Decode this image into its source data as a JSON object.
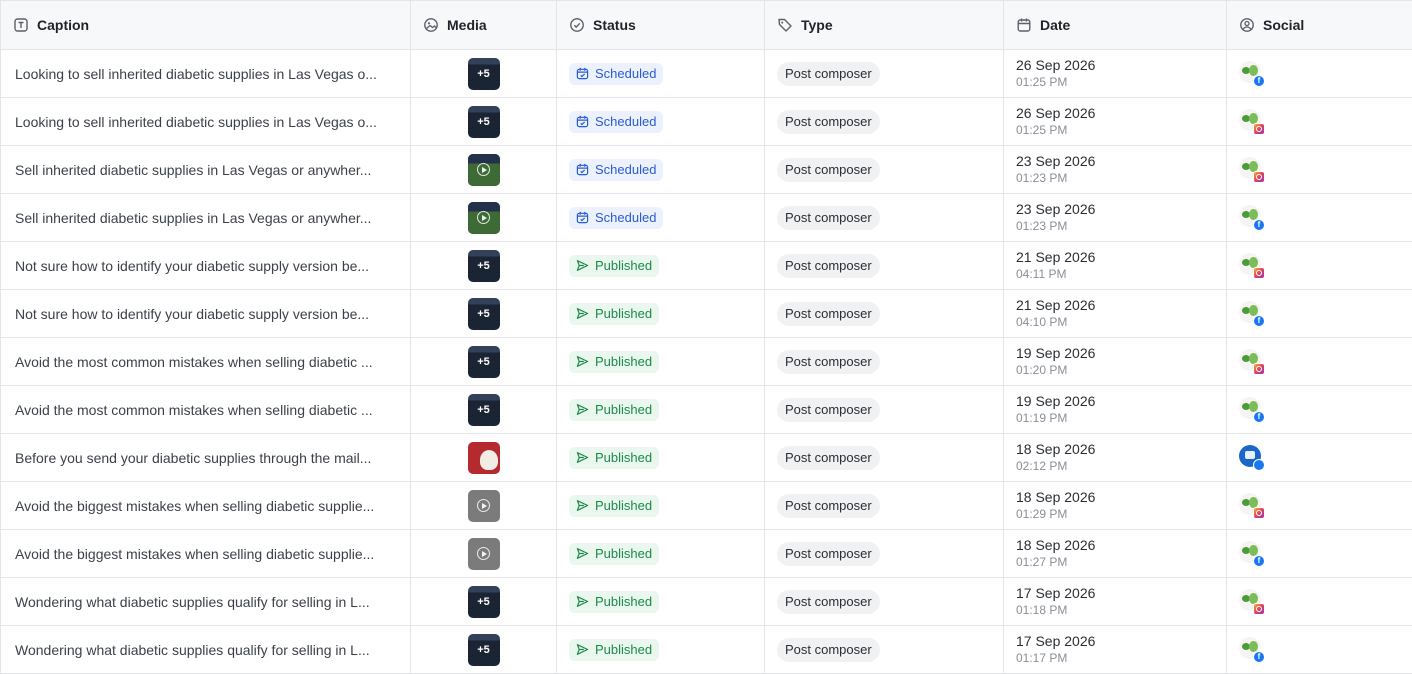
{
  "headers": {
    "caption": "Caption",
    "media": "Media",
    "status": "Status",
    "type": "Type",
    "date": "Date",
    "social": "Social"
  },
  "rows": [
    {
      "caption": "Looking to sell inherited diabetic supplies in Las Vegas o...",
      "media": "plus5",
      "media_text": "+5",
      "status": "Scheduled",
      "type": "Post composer",
      "date": "26 Sep 2026",
      "time": "01:25 PM",
      "network": "facebook"
    },
    {
      "caption": "Looking to sell inherited diabetic supplies in Las Vegas o...",
      "media": "plus5",
      "media_text": "+5",
      "status": "Scheduled",
      "type": "Post composer",
      "date": "26 Sep 2026",
      "time": "01:25 PM",
      "network": "instagram"
    },
    {
      "caption": "Sell inherited diabetic supplies in Las Vegas or anywher...",
      "media": "video",
      "media_text": "",
      "status": "Scheduled",
      "type": "Post composer",
      "date": "23 Sep 2026",
      "time": "01:23 PM",
      "network": "instagram"
    },
    {
      "caption": "Sell inherited diabetic supplies in Las Vegas or anywher...",
      "media": "video",
      "media_text": "",
      "status": "Scheduled",
      "type": "Post composer",
      "date": "23 Sep 2026",
      "time": "01:23 PM",
      "network": "facebook"
    },
    {
      "caption": "Not sure how to identify your diabetic supply version be...",
      "media": "plus5",
      "media_text": "+5",
      "status": "Published",
      "type": "Post composer",
      "date": "21 Sep 2026",
      "time": "04:11 PM",
      "network": "instagram"
    },
    {
      "caption": "Not sure how to identify your diabetic supply version be...",
      "media": "plus5",
      "media_text": "+5",
      "status": "Published",
      "type": "Post composer",
      "date": "21 Sep 2026",
      "time": "04:10 PM",
      "network": "facebook"
    },
    {
      "caption": "Avoid the most common mistakes when selling diabetic ...",
      "media": "plus5",
      "media_text": "+5",
      "status": "Published",
      "type": "Post composer",
      "date": "19 Sep 2026",
      "time": "01:20 PM",
      "network": "instagram"
    },
    {
      "caption": "Avoid the most common mistakes when selling diabetic ...",
      "media": "plus5",
      "media_text": "+5",
      "status": "Published",
      "type": "Post composer",
      "date": "19 Sep 2026",
      "time": "01:19 PM",
      "network": "facebook"
    },
    {
      "caption": "Before you send your diabetic supplies through the mail...",
      "media": "image-red",
      "media_text": "",
      "status": "Published",
      "type": "Post composer",
      "date": "18 Sep 2026",
      "time": "02:12 PM",
      "network": "business"
    },
    {
      "caption": "Avoid the biggest mistakes when selling diabetic supplie...",
      "media": "video-grey",
      "media_text": "",
      "status": "Published",
      "type": "Post composer",
      "date": "18 Sep 2026",
      "time": "01:29 PM",
      "network": "instagram"
    },
    {
      "caption": "Avoid the biggest mistakes when selling diabetic supplie...",
      "media": "video-grey",
      "media_text": "",
      "status": "Published",
      "type": "Post composer",
      "date": "18 Sep 2026",
      "time": "01:27 PM",
      "network": "facebook"
    },
    {
      "caption": "Wondering what diabetic supplies qualify for selling in L...",
      "media": "plus5",
      "media_text": "+5",
      "status": "Published",
      "type": "Post composer",
      "date": "17 Sep 2026",
      "time": "01:18 PM",
      "network": "instagram"
    },
    {
      "caption": "Wondering what diabetic supplies qualify for selling in L...",
      "media": "plus5",
      "media_text": "+5",
      "status": "Published",
      "type": "Post composer",
      "date": "17 Sep 2026",
      "time": "01:17 PM",
      "network": "facebook"
    }
  ],
  "colors": {
    "scheduled_bg": "#ebf1fd",
    "scheduled_fg": "#2b5bd7",
    "published_bg": "#e9f7ee",
    "published_fg": "#1d8a4a",
    "facebook": "#1877f2"
  }
}
